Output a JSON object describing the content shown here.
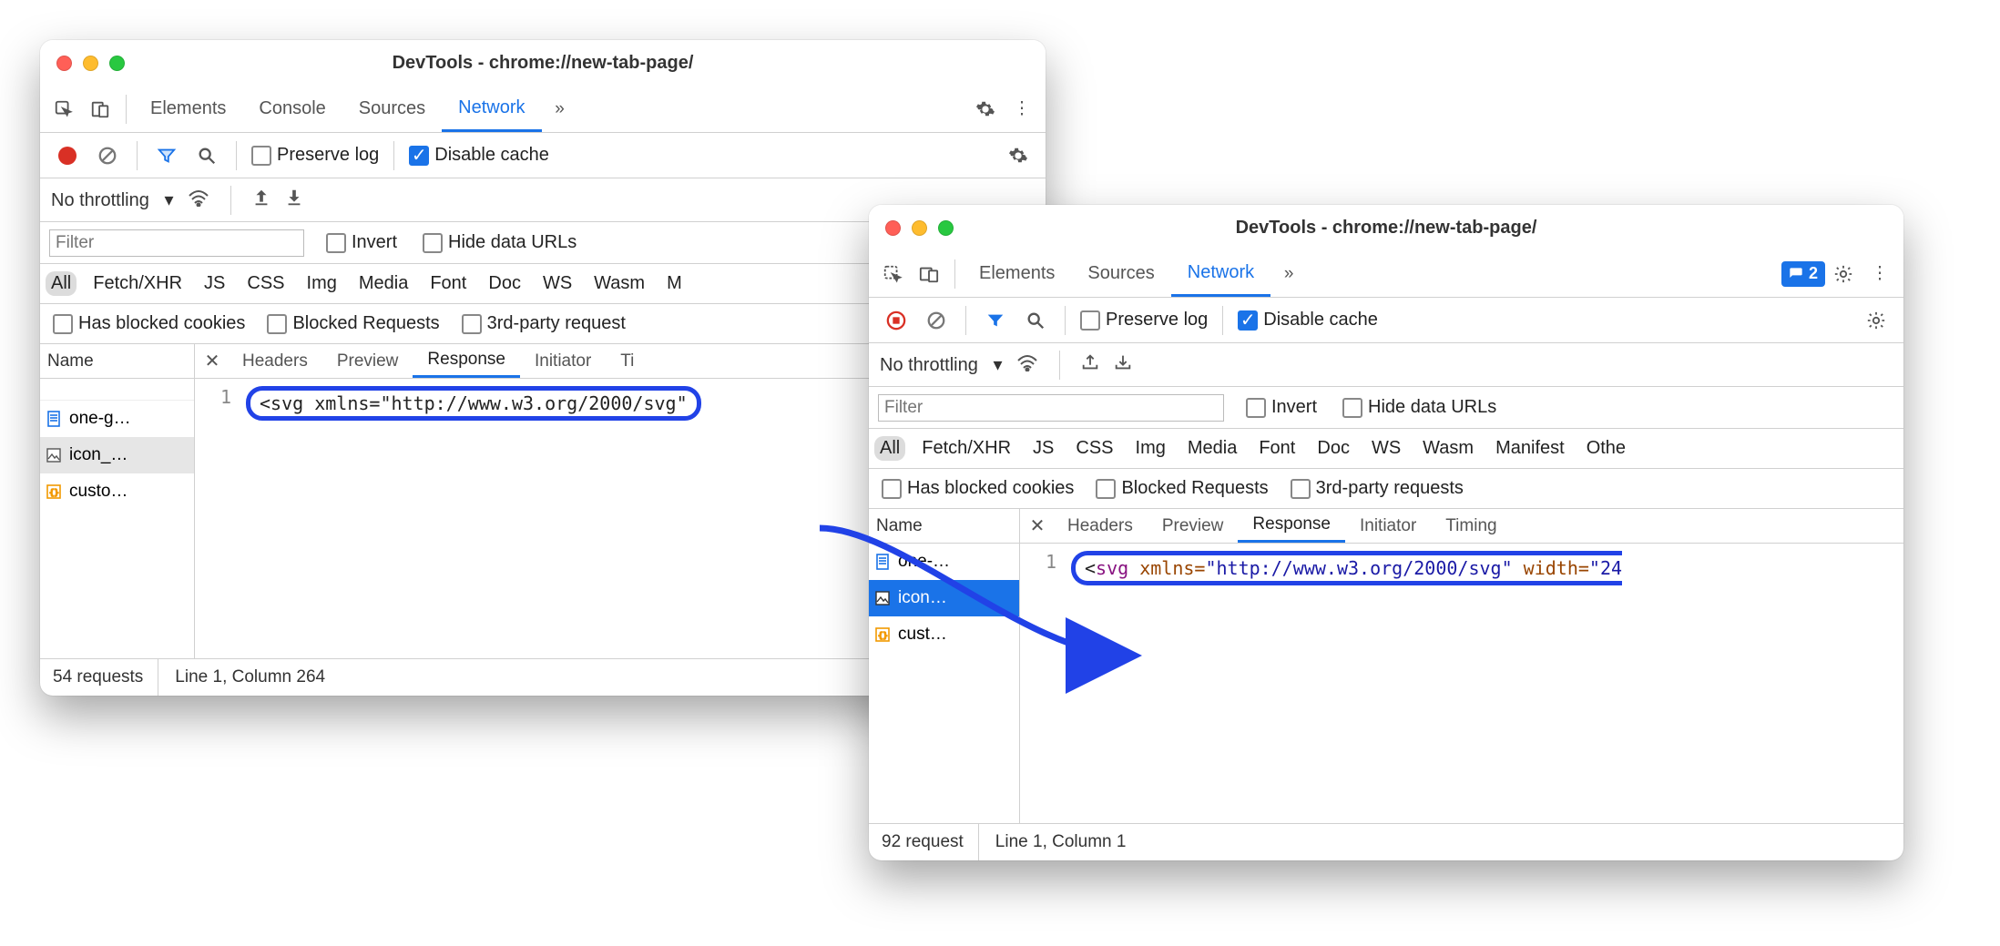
{
  "window_left": {
    "title": "DevTools - chrome://new-tab-page/",
    "tabs": [
      "Elements",
      "Console",
      "Sources",
      "Network"
    ],
    "active_tab": 3,
    "preserve_log_label": "Preserve log",
    "disable_cache_label": "Disable cache",
    "throttling_label": "No throttling",
    "filter_placeholder": "Filter",
    "invert_label": "Invert",
    "hide_urls_label": "Hide data URLs",
    "filter_chips": [
      "All",
      "Fetch/XHR",
      "JS",
      "CSS",
      "Img",
      "Media",
      "Font",
      "Doc",
      "WS",
      "Wasm",
      "M"
    ],
    "blocked_labels": [
      "Has blocked cookies",
      "Blocked Requests",
      "3rd-party request"
    ],
    "name_header": "Name",
    "files": [
      "one-g…",
      "icon_…",
      "custo…"
    ],
    "subtabs": [
      "Headers",
      "Preview",
      "Response",
      "Initiator",
      "Ti"
    ],
    "active_subtab": 2,
    "line_no": "1",
    "code_tag": "<svg",
    "code_attr": "xmlns=",
    "code_str": "\"http://www.w3.org/2000/svg\"",
    "status_requests": "54 requests",
    "status_cursor": "Line 1, Column 264"
  },
  "window_right": {
    "title": "DevTools - chrome://new-tab-page/",
    "tabs": [
      "Elements",
      "Sources",
      "Network"
    ],
    "active_tab": 2,
    "issues_count": "2",
    "preserve_log_label": "Preserve log",
    "disable_cache_label": "Disable cache",
    "throttling_label": "No throttling",
    "filter_placeholder": "Filter",
    "invert_label": "Invert",
    "hide_urls_label": "Hide data URLs",
    "filter_chips": [
      "All",
      "Fetch/XHR",
      "JS",
      "CSS",
      "Img",
      "Media",
      "Font",
      "Doc",
      "WS",
      "Wasm",
      "Manifest",
      "Othe"
    ],
    "blocked_labels": [
      "Has blocked cookies",
      "Blocked Requests",
      "3rd-party requests"
    ],
    "name_header": "Name",
    "files": [
      "one-…",
      "icon…",
      "cust…"
    ],
    "subtabs": [
      "Headers",
      "Preview",
      "Response",
      "Initiator",
      "Timing"
    ],
    "active_subtab": 2,
    "line_no": "1",
    "code_tag": "<svg",
    "code_attr1": "xmlns=",
    "code_str1": "\"http://www.w3.org/2000/svg\"",
    "code_attr2": "width=",
    "code_str2": "\"24",
    "status_requests": "92 request",
    "status_cursor": "Line 1, Column 1"
  }
}
